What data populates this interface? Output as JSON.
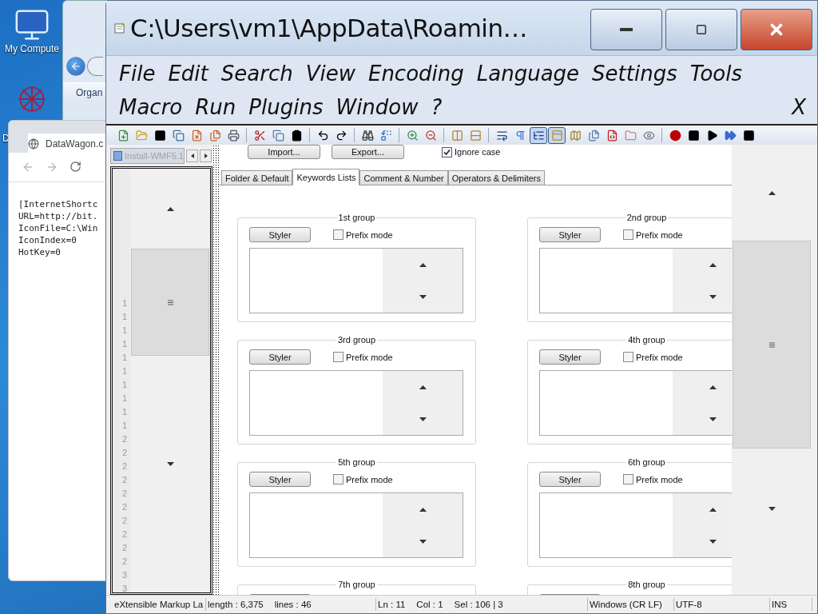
{
  "desktop": {
    "icons": [
      {
        "label": "My Compute"
      },
      {
        "label": "D"
      }
    ]
  },
  "explorer": {
    "toolbar_label": "Organ"
  },
  "browser": {
    "tab_title": "DataWagon.c",
    "lines": [
      "[InternetShortc",
      "URL=http://bit.",
      "IconFile=C:\\Win",
      "IconIndex=0",
      "HotKey=0"
    ]
  },
  "window": {
    "title": "C:\\Users\\vm1\\AppData\\Roamin…"
  },
  "menu": {
    "rows": [
      [
        "File",
        "Edit",
        "Search",
        "View",
        "Encoding",
        "Language",
        "Settings",
        "Tools"
      ],
      [
        "Macro",
        "Run",
        "Plugins",
        "Window",
        "?"
      ]
    ],
    "close": "X"
  },
  "toolbar": [
    {
      "kind": "new",
      "on": false
    },
    {
      "kind": "open",
      "on": false
    },
    {
      "kind": "block",
      "on": false
    },
    {
      "kind": "saveall",
      "on": false
    },
    {
      "kind": "close",
      "on": false
    },
    {
      "kind": "closeall",
      "on": false
    },
    {
      "kind": "print",
      "on": false
    },
    {
      "kind": "sep"
    },
    {
      "kind": "cut",
      "on": false
    },
    {
      "kind": "copy",
      "on": false
    },
    {
      "kind": "paste",
      "on": false
    },
    {
      "kind": "sep"
    },
    {
      "kind": "undo",
      "on": false
    },
    {
      "kind": "redo",
      "on": false
    },
    {
      "kind": "sep"
    },
    {
      "kind": "find",
      "on": false
    },
    {
      "kind": "replace",
      "on": false
    },
    {
      "kind": "sep"
    },
    {
      "kind": "zoomin",
      "on": false
    },
    {
      "kind": "zoomout",
      "on": false
    },
    {
      "kind": "sep"
    },
    {
      "kind": "syncv",
      "on": false
    },
    {
      "kind": "synch",
      "on": false
    },
    {
      "kind": "sep"
    },
    {
      "kind": "wrap",
      "on": false
    },
    {
      "kind": "pilcrow",
      "on": false
    },
    {
      "kind": "indent",
      "on": true
    },
    {
      "kind": "panel",
      "on": true
    },
    {
      "kind": "map",
      "on": false
    },
    {
      "kind": "docs",
      "on": false
    },
    {
      "kind": "function",
      "on": false
    },
    {
      "kind": "folder",
      "on": false
    },
    {
      "kind": "eye",
      "on": false
    },
    {
      "kind": "sep"
    },
    {
      "kind": "record",
      "on": false
    },
    {
      "kind": "stop",
      "on": false
    },
    {
      "kind": "play",
      "on": false
    },
    {
      "kind": "fastforward",
      "on": false
    },
    {
      "kind": "block",
      "on": false
    }
  ],
  "doc_panel": {
    "tab": "Install-WMF5.1",
    "line_numbers": [
      "1",
      "1",
      "1",
      "1",
      "1",
      "1",
      "1",
      "1",
      "1",
      "1",
      "2",
      "2",
      "2",
      "2",
      "2",
      "2",
      "2",
      "2",
      "2",
      "2",
      "3",
      "3"
    ]
  },
  "panel": {
    "import": "Import...",
    "export": "Export...",
    "ignore_case": {
      "label": "Ignore case",
      "checked": true
    },
    "tabs": [
      {
        "label": "Folder & Default",
        "selected": false
      },
      {
        "label": "Keywords Lists",
        "selected": true
      },
      {
        "label": "Comment & Number",
        "selected": false
      },
      {
        "label": "Operators & Delimiters",
        "selected": false
      }
    ],
    "groups": [
      {
        "title": "1st group",
        "styler": "Styler",
        "prefix": {
          "label": "Prefix mode",
          "checked": false
        }
      },
      {
        "title": "2nd group",
        "styler": "Styler",
        "prefix": {
          "label": "Prefix mode",
          "checked": false
        }
      },
      {
        "title": "3rd group",
        "styler": "Styler",
        "prefix": {
          "label": "Prefix mode",
          "checked": false
        }
      },
      {
        "title": "4th group",
        "styler": "Styler",
        "prefix": {
          "label": "Prefix mode",
          "checked": false
        }
      },
      {
        "title": "5th group",
        "styler": "Styler",
        "prefix": {
          "label": "Prefix mode",
          "checked": false
        }
      },
      {
        "title": "6th group",
        "styler": "Styler",
        "prefix": {
          "label": "Prefix mode",
          "checked": false
        }
      },
      {
        "title": "7th group"
      },
      {
        "title": "8th group"
      }
    ]
  },
  "status_bar": [
    {
      "items": [
        "eXtensible Markup La"
      ]
    },
    {
      "items": [
        "length : 6,375",
        "lines : 46"
      ]
    },
    {
      "items": [
        "Ln : 11",
        "Col : 1",
        "Sel : 106 | 3"
      ]
    },
    {
      "items": [
        "Windows (CR LF)"
      ]
    },
    {
      "items": [
        "UTF-8"
      ]
    },
    {
      "items": [
        "INS"
      ]
    }
  ]
}
